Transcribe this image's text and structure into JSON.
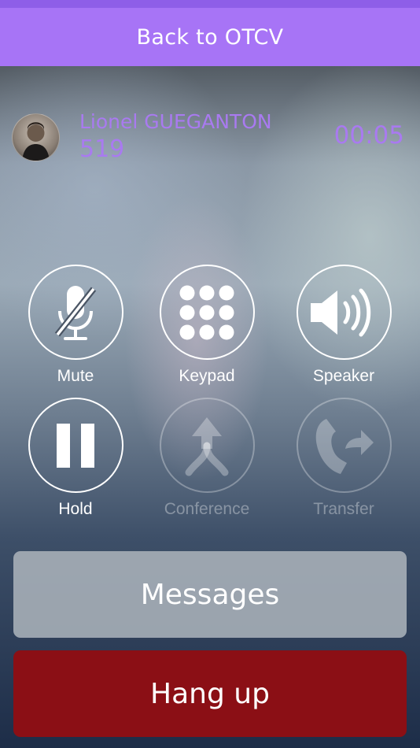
{
  "header": {
    "back_label": "Back to OTCV"
  },
  "call": {
    "caller_name": "Lionel GUEGANTON",
    "caller_number": "519",
    "duration": "00:05"
  },
  "controls": [
    {
      "label": "Mute",
      "icon": "muted-microphone-icon",
      "enabled": true
    },
    {
      "label": "Keypad",
      "icon": "keypad-icon",
      "enabled": true
    },
    {
      "label": "Speaker",
      "icon": "speaker-icon",
      "enabled": true
    },
    {
      "label": "Hold",
      "icon": "pause-icon",
      "enabled": true
    },
    {
      "label": "Conference",
      "icon": "merge-arrow-icon",
      "enabled": false
    },
    {
      "label": "Transfer",
      "icon": "phone-forward-icon",
      "enabled": false
    }
  ],
  "actions": {
    "messages_label": "Messages",
    "hangup_label": "Hang up"
  },
  "colors": {
    "accent": "#a774f6",
    "accent_text": "#a97af0",
    "hangup": "#8b0f15"
  }
}
